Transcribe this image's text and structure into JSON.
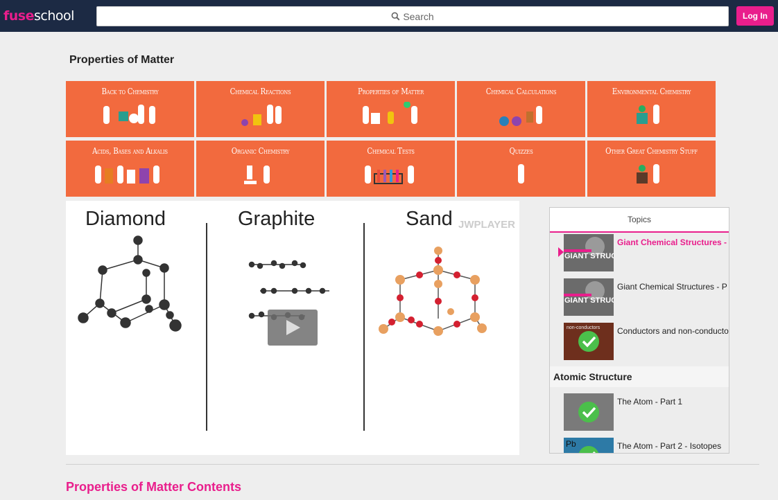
{
  "header": {
    "logo_fuse": "fuse",
    "logo_school": "school",
    "search_placeholder": "Search",
    "login_label": "Log In"
  },
  "page": {
    "title": "Properties of Matter",
    "contents_heading": "Properties of Matter Contents"
  },
  "tiles": [
    {
      "label": "Back to Chemistry"
    },
    {
      "label": "Chemical Reactions"
    },
    {
      "label": "Properties of Matter"
    },
    {
      "label": "Chemical Calculations"
    },
    {
      "label": "Environmental Chemistry"
    },
    {
      "label": "Acids, Bases and Alkalis"
    },
    {
      "label": "Organic Chemistry"
    },
    {
      "label": "Chemical Tests"
    },
    {
      "label": "Quizzes"
    },
    {
      "label": "Other Great Chemistry Stuff"
    }
  ],
  "video": {
    "labels": [
      "Diamond",
      "Graphite",
      "Sand"
    ],
    "watermark": "JWPLAYER"
  },
  "sidebar": {
    "header": "Topics",
    "items": [
      {
        "title": "Giant Chemical Structures - P",
        "active": true,
        "thumb_text": "GIANT STRUCTURE"
      },
      {
        "title": "Giant Chemical Structures - P",
        "active": false,
        "thumb_text": "GIANT STRUCTURE"
      },
      {
        "title": "Conductors and non-conducto",
        "active": false,
        "thumb_text": "non-conductors"
      }
    ],
    "section_title": "Atomic Structure",
    "section_items": [
      {
        "title": "The Atom - Part 1"
      },
      {
        "title": "The Atom - Part 2 - Isotopes",
        "thumb_text": "Pb"
      }
    ]
  },
  "colors": {
    "brand_pink": "#e91e8c",
    "header_bg": "#1c2a44",
    "tile_orange": "#f26a3e"
  }
}
